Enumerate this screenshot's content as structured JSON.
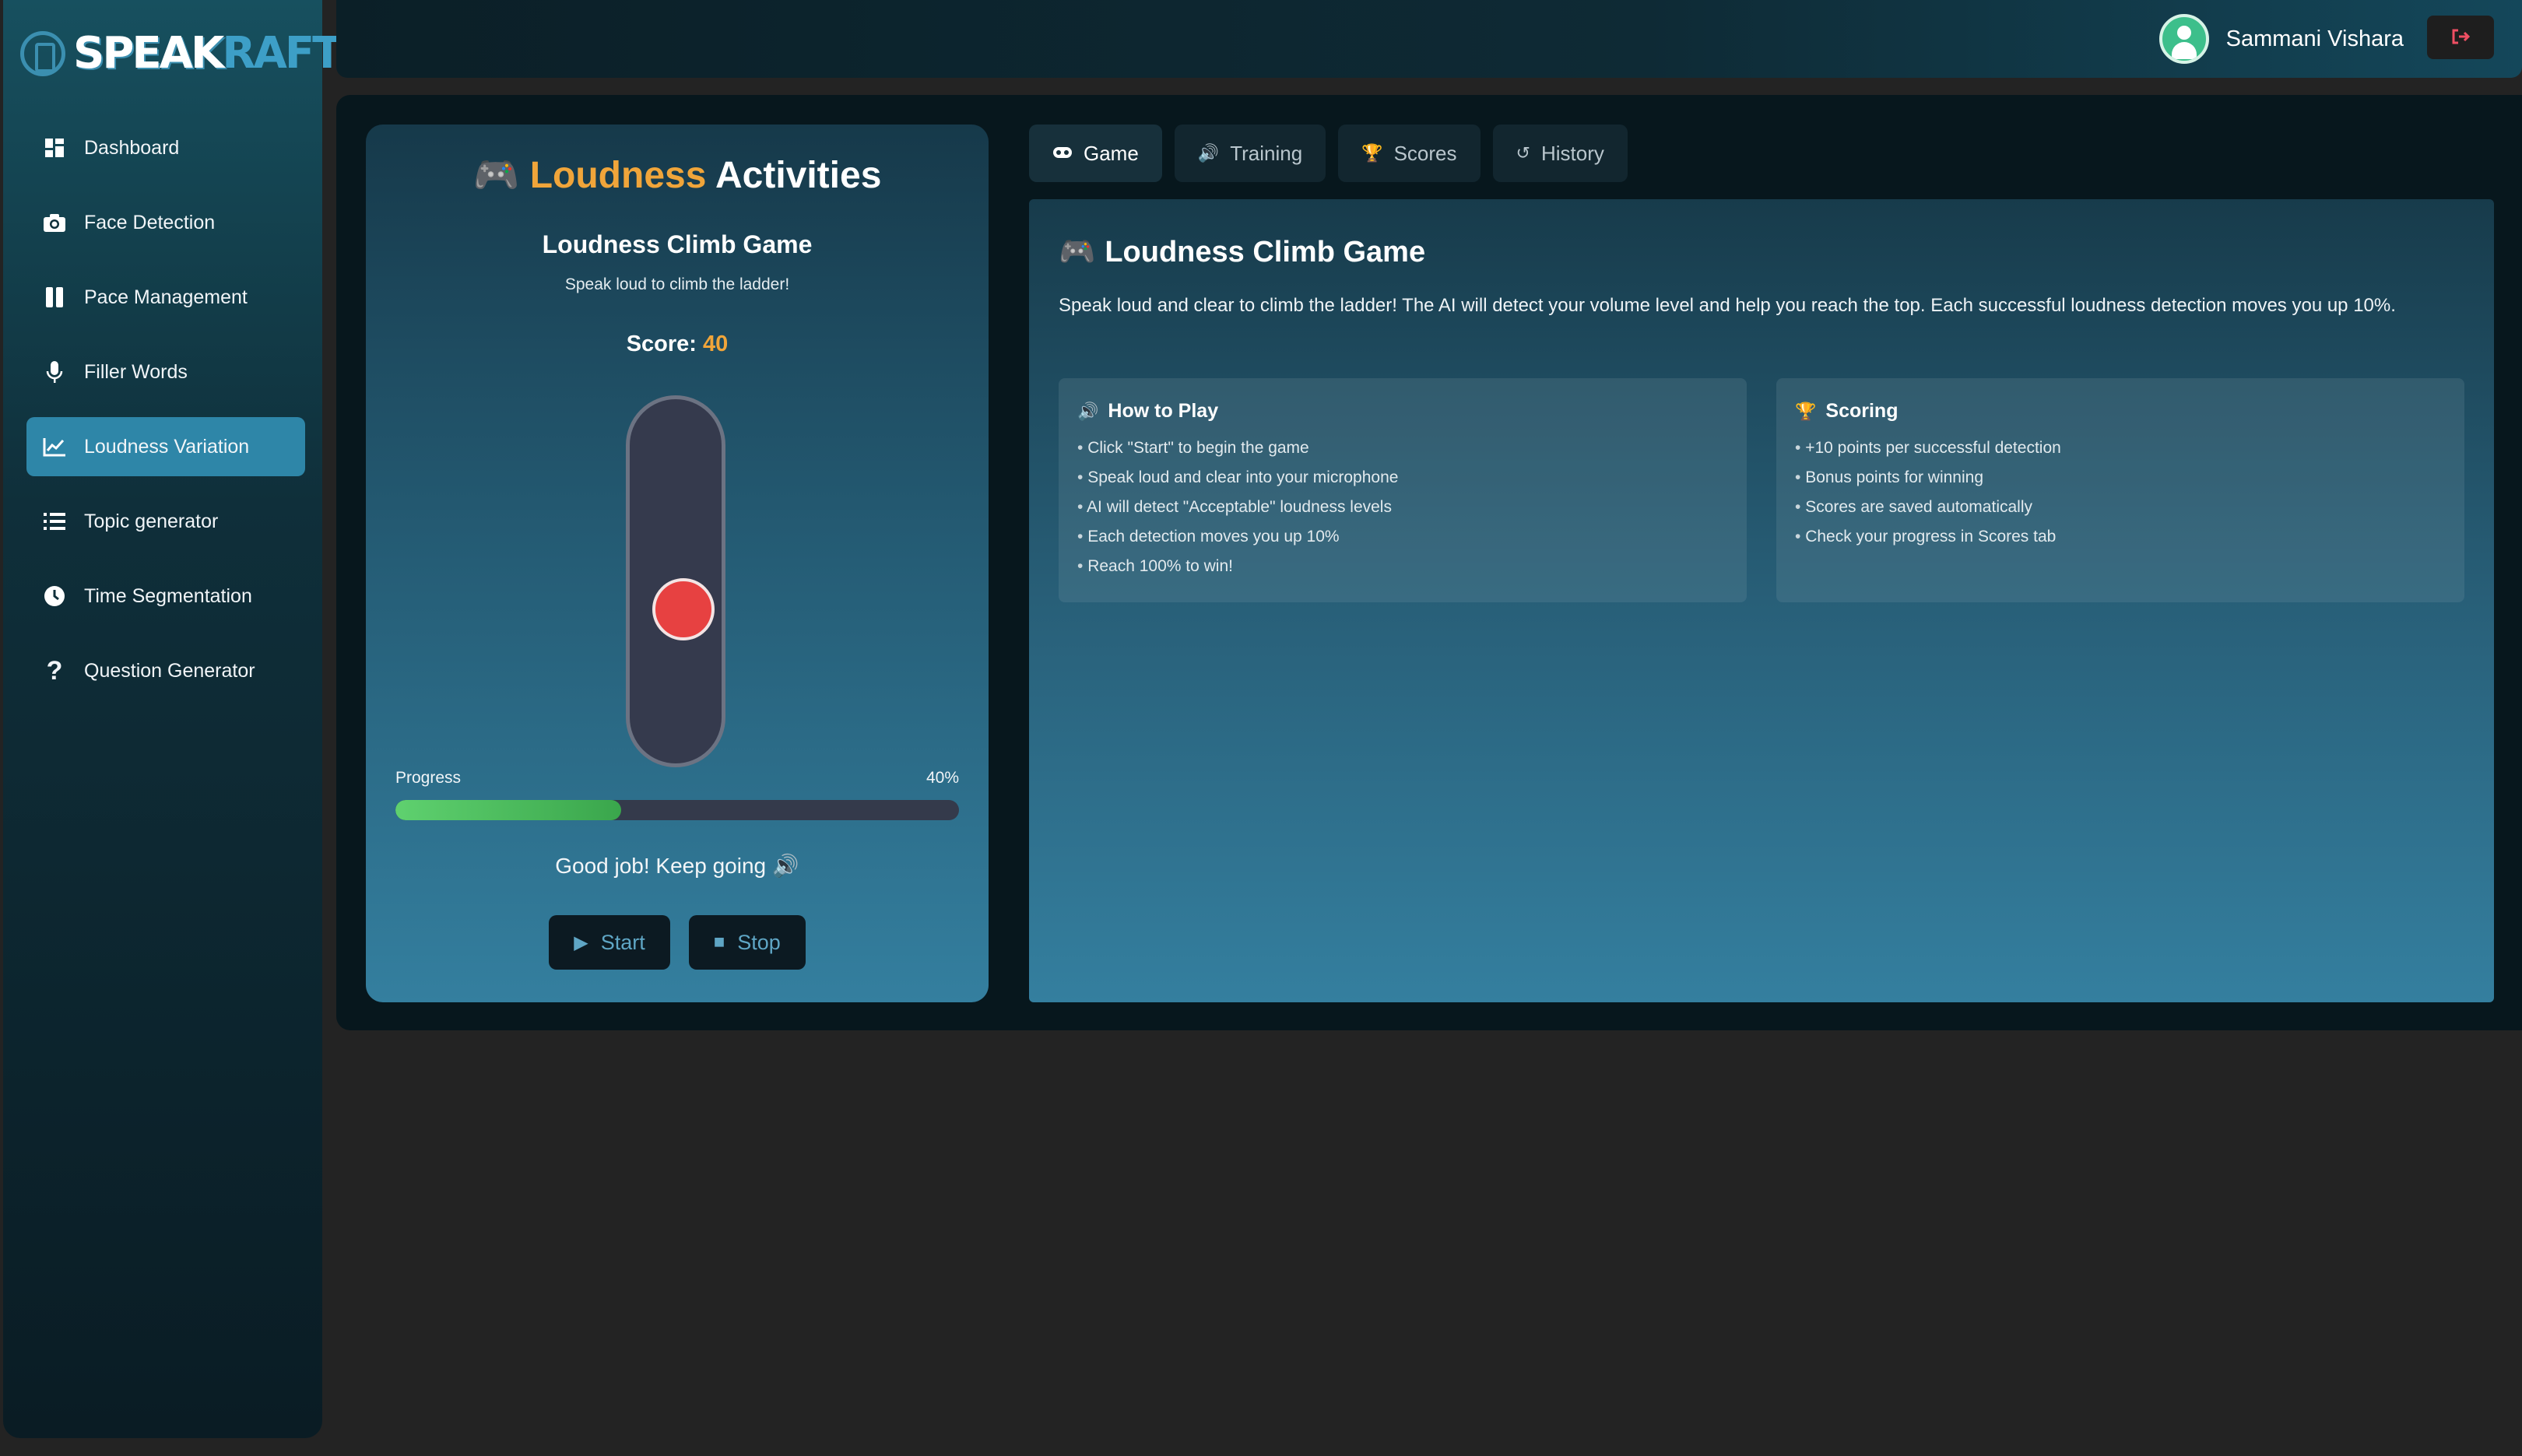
{
  "app": {
    "logo_primary": "SPEAK",
    "logo_secondary": "RAFT"
  },
  "sidebar": {
    "items": [
      {
        "label": "Dashboard",
        "icon": "dashboard-icon",
        "active": false
      },
      {
        "label": "Face Detection",
        "icon": "camera-icon",
        "active": false
      },
      {
        "label": "Pace Management",
        "icon": "pause-icon",
        "active": false
      },
      {
        "label": "Filler Words",
        "icon": "microphone-icon",
        "active": false
      },
      {
        "label": "Loudness Variation",
        "icon": "chart-line-icon",
        "active": true
      },
      {
        "label": "Topic generator",
        "icon": "list-icon",
        "active": false
      },
      {
        "label": "Time Segmentation",
        "icon": "clock-icon",
        "active": false
      },
      {
        "label": "Question Generator",
        "icon": "question-icon",
        "active": false
      }
    ]
  },
  "header": {
    "username": "Sammani Vishara",
    "logout_icon": "logout-icon"
  },
  "activity_card": {
    "title_accent": "Loudness",
    "title_rest": "Activities",
    "game_title": "Loudness Climb Game",
    "game_subtitle": "Speak loud to climb the ladder!",
    "score_label": "Score:",
    "score_value": "40",
    "progress_label": "Progress",
    "progress_text": "40%",
    "progress_fraction": 0.4,
    "feedback": "Good job! Keep going 🔊",
    "start_label": "Start",
    "stop_label": "Stop"
  },
  "tabs": [
    {
      "label": "Game",
      "icon": "gamepad-icon",
      "active": true
    },
    {
      "label": "Training",
      "icon": "speaker-icon",
      "active": false
    },
    {
      "label": "Scores",
      "icon": "trophy-icon",
      "active": false
    },
    {
      "label": "History",
      "icon": "history-icon",
      "active": false
    }
  ],
  "game_panel": {
    "title": "Loudness Climb Game",
    "description": "Speak loud and clear to climb the ladder! The AI will detect your volume level and help you reach the top. Each successful loudness detection moves you up 10%.",
    "how_to_play": {
      "heading": "How to Play",
      "items": [
        "Click \"Start\" to begin the game",
        "Speak loud and clear into your microphone",
        "AI will detect \"Acceptable\" loudness levels",
        "Each detection moves you up 10%",
        "Reach 100% to win!"
      ]
    },
    "scoring": {
      "heading": "Scoring",
      "items": [
        "+10 points per successful detection",
        "Bonus points for winning",
        "Scores are saved automatically",
        "Check your progress in Scores tab"
      ]
    }
  },
  "colors": {
    "accent_orange": "#f0a53a",
    "active_nav": "#2e86a8",
    "ball_red": "#e74141",
    "progress_green": "#4cc05e"
  }
}
